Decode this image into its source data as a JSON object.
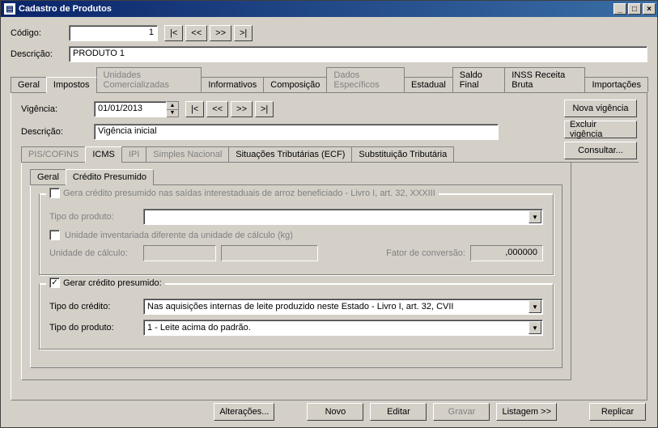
{
  "window": {
    "title": "Cadastro de Produtos"
  },
  "header": {
    "codigo_label": "Código:",
    "codigo_value": "1",
    "descricao_label": "Descrição:",
    "descricao_value": "PRODUTO 1",
    "nav": {
      "first": "|<",
      "prev": "<<",
      "next": ">>",
      "last": ">|"
    }
  },
  "tabs": {
    "geral": "Geral",
    "impostos": "Impostos",
    "unidades": "Unidades Comercializadas",
    "informativos": "Informativos",
    "composicao": "Composição",
    "dados": "Dados Específicos",
    "estadual": "Estadual",
    "saldo": "Saldo Final",
    "inss": "INSS Receita Bruta",
    "import": "Importações"
  },
  "vigencia": {
    "label": "Vigência:",
    "data": "01/01/2013",
    "descricao_label": "Descrição:",
    "descricao_value": "Vigência inicial",
    "nav": {
      "first": "|<",
      "prev": "<<",
      "next": ">>",
      "last": ">|"
    }
  },
  "side_buttons": {
    "nova": "Nova vigência",
    "excluir": "Excluir vigência",
    "consultar": "Consultar..."
  },
  "subtabs": {
    "pis": "PIS/COFINS",
    "icms": "ICMS",
    "ipi": "IPI",
    "simples": "Simples Nacional",
    "situ": "Situações Tributárias (ECF)",
    "subst": "Substituição Tributária"
  },
  "inner_tabs": {
    "geral": "Geral",
    "credito": "Crédito Presumido"
  },
  "group1": {
    "legend": "Gera crédito presumido nas saídas interestaduais de arroz beneficiado - Livro I, art. 32, XXXIII",
    "tipo_produto_label": "Tipo do produto:",
    "tipo_produto_value": "",
    "unidade_chk": "Unidade inventariada diferente da unidade de cálculo (kg)",
    "unidade_calc_label": "Unidade de cálculo:",
    "fator_label": "Fator de conversão:",
    "fator_value": ",000000"
  },
  "group2": {
    "legend": "Gerar crédito presumido:",
    "checked": true,
    "tipo_credito_label": "Tipo do crédito:",
    "tipo_credito_value": "Nas aquisições internas de leite produzido neste Estado - Livro I, art. 32, CVII",
    "tipo_produto_label": "Tipo do produto:",
    "tipo_produto_value": "1 - Leite acima do padrão."
  },
  "footer": {
    "alteracoes": "Alterações...",
    "novo": "Novo",
    "editar": "Editar",
    "gravar": "Gravar",
    "listagem": "Listagem >>",
    "replicar": "Replicar"
  }
}
